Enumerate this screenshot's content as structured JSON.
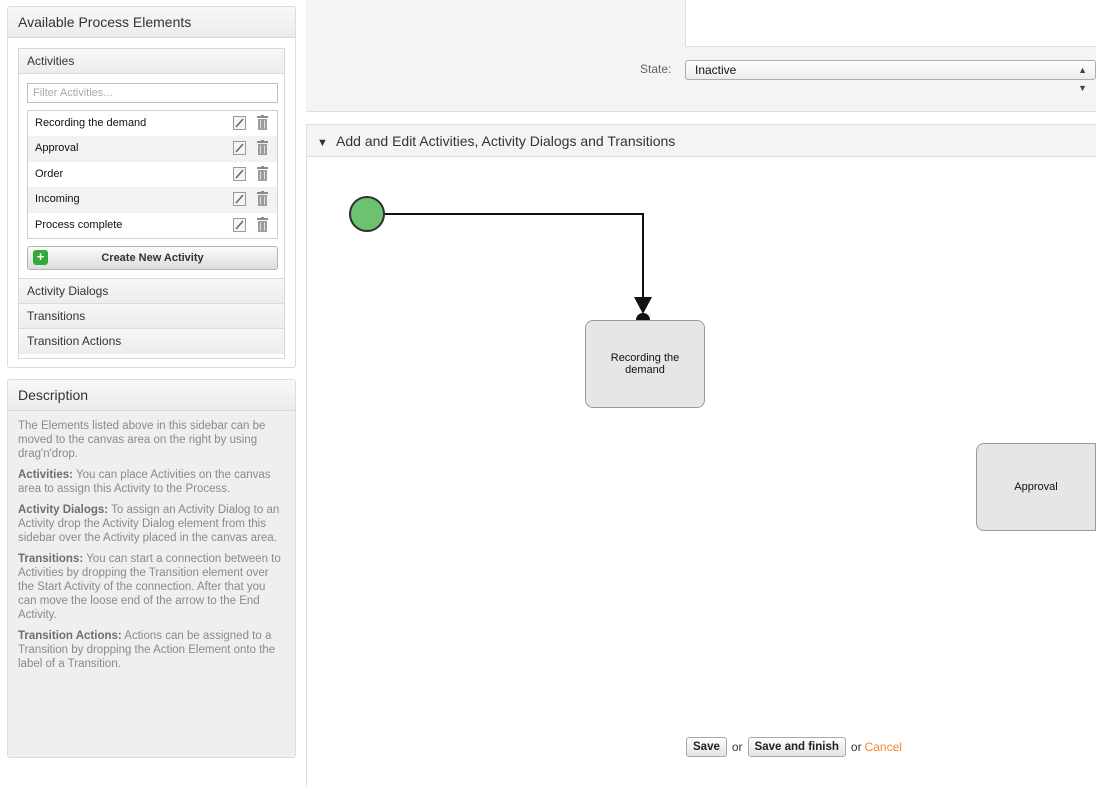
{
  "sidebar": {
    "elements_title": "Available Process Elements",
    "activities_label": "Activities",
    "filter_placeholder": "Filter Activities...",
    "activities": [
      {
        "label": "Recording the demand"
      },
      {
        "label": "Approval"
      },
      {
        "label": "Order"
      },
      {
        "label": "Incoming"
      },
      {
        "label": "Process complete"
      }
    ],
    "create_button": "Create New Activity",
    "sections": [
      {
        "label": "Activity Dialogs"
      },
      {
        "label": "Transitions"
      },
      {
        "label": "Transition Actions"
      }
    ]
  },
  "description": {
    "title": "Description",
    "intro": "The Elements listed above in this sidebar can be moved to the canvas area on the right by using drag'n'drop.",
    "items": [
      {
        "term": "Activities:",
        "text": "You can place Activities on the canvas area to assign this Activity to the Process."
      },
      {
        "term": "Activity Dialogs:",
        "text": "To assign an Activity Dialog to an Activity drop the Activity Dialog element from this sidebar over the Activity placed in the canvas area."
      },
      {
        "term": "Transitions:",
        "text": "You can start a connection between to Activities by dropping the Transition element over the Start Activity of the connection. After that you can move the loose end of the arrow to the End Activity."
      },
      {
        "term": "Transition Actions:",
        "text": "Actions can be assigned to a Transition by dropping the Action Element onto the label of a Transition."
      }
    ]
  },
  "state": {
    "label": "State:",
    "value": "Inactive"
  },
  "canvas": {
    "title": "Add and Edit Activities, Activity Dialogs and Transitions",
    "nodes": [
      {
        "label": "Recording the demand"
      },
      {
        "label": "Approval"
      }
    ]
  },
  "actions": {
    "save": "Save",
    "or1": "or",
    "save_finish": "Save and finish",
    "or2": "or",
    "cancel": "Cancel"
  },
  "colors": {
    "start_node": "#6cc26f",
    "cancel_link": "#f08a24",
    "create_plus": "#34a83c"
  }
}
